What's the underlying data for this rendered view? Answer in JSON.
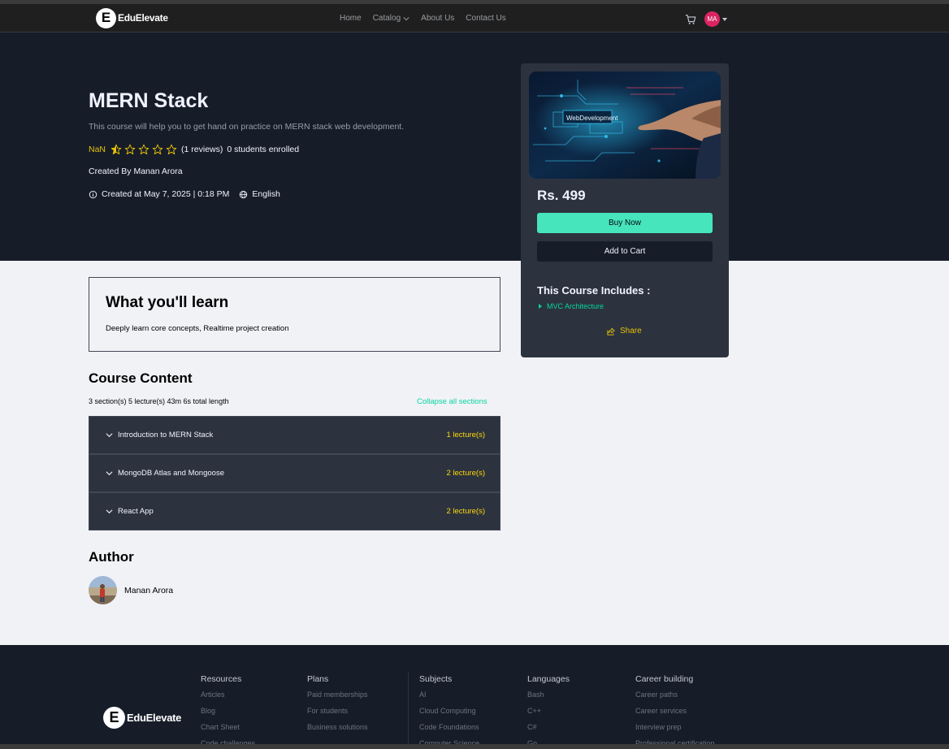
{
  "nav": {
    "logo_letter": "E",
    "logo_text": "EduElevate",
    "links": [
      "Home",
      "Catalog",
      "About Us",
      "Contact Us"
    ],
    "avatar_initials": "MA"
  },
  "course": {
    "title": "MERN Stack",
    "description": "This course will help you to get hand on practice on MERN stack web development.",
    "rating_value": "NaN",
    "stars_filled": 0.5,
    "stars_total": 5,
    "reviews": "(1 reviews)",
    "enrolled": "0 students enrolled",
    "created_by": "Created By Manan Arora",
    "created_at": "Created at May 7, 2025 | 0:18 PM",
    "language": "English"
  },
  "card": {
    "price": "Rs. 499",
    "buy_label": "Buy Now",
    "cart_label": "Add to Cart",
    "includes_title": "This Course Includes :",
    "includes_items": [
      "MVC Architecture"
    ],
    "share_label": "Share",
    "thumbnail_text": "WebDevelopment"
  },
  "learn": {
    "title": "What you'll learn",
    "text": "Deeply learn core concepts, Realtime project creation"
  },
  "content": {
    "title": "Course Content",
    "summary": "3 section(s) 5 lecture(s) 43m 6s total length",
    "collapse_label": "Collapse all sections",
    "sections": [
      {
        "name": "Introduction to MERN Stack",
        "count": "1 lecture(s)"
      },
      {
        "name": "MongoDB Atlas and Mongoose",
        "count": "2 lecture(s)"
      },
      {
        "name": "React App",
        "count": "2 lecture(s)"
      }
    ]
  },
  "author": {
    "title": "Author",
    "name": "Manan Arora"
  },
  "footer": {
    "logo_text": "EduElevate",
    "columns": [
      {
        "title": "Resources",
        "items": [
          "Articles",
          "Blog",
          "Chart Sheet",
          "Code challenges"
        ]
      },
      {
        "title": "Plans",
        "items": [
          "Paid memberships",
          "For students",
          "Business solutions"
        ]
      },
      {
        "title": "Subjects",
        "items": [
          "AI",
          "Cloud Computing",
          "Code Foundations",
          "Computer Science"
        ]
      },
      {
        "title": "Languages",
        "items": [
          "Bash",
          "C++",
          "C#",
          "Go"
        ]
      },
      {
        "title": "Career building",
        "items": [
          "Career paths",
          "Career services",
          "Interview prep",
          "Professional certification"
        ]
      }
    ]
  },
  "colors": {
    "accent_teal": "#47e5bc",
    "accent_yellow": "#e7c009",
    "hero_bg": "#161d29",
    "card_bg": "#2c333f",
    "avatar_bg": "#dc2462"
  }
}
